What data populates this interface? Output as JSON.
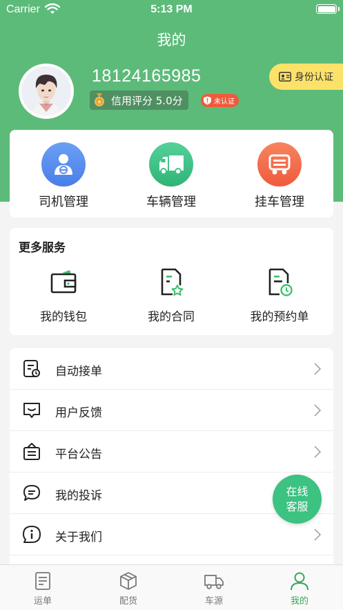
{
  "status_bar": {
    "carrier": "Carrier",
    "time": "5:13 PM"
  },
  "header": {
    "title": "我的"
  },
  "profile": {
    "phone": "18124165985",
    "credit_label": "信用评分 5.0分",
    "verify_status": "未认证",
    "id_verify_button": "身份认证"
  },
  "management": [
    {
      "label": "司机管理",
      "icon": "driver-icon",
      "color": "#5b8ff0"
    },
    {
      "label": "车辆管理",
      "icon": "truck-icon",
      "color": "#3ec18a"
    },
    {
      "label": "挂车管理",
      "icon": "trailer-icon",
      "color": "#f46d4d"
    }
  ],
  "services": {
    "title": "更多服务",
    "items": [
      {
        "label": "我的钱包",
        "icon": "wallet-icon"
      },
      {
        "label": "我的合同",
        "icon": "contract-icon"
      },
      {
        "label": "我的预约单",
        "icon": "appointment-icon"
      }
    ]
  },
  "menu": [
    {
      "label": "自动接单",
      "icon": "auto-order-icon"
    },
    {
      "label": "用户反馈",
      "icon": "feedback-icon"
    },
    {
      "label": "平台公告",
      "icon": "announcement-icon"
    },
    {
      "label": "我的投诉",
      "icon": "complaint-icon"
    },
    {
      "label": "关于我们",
      "icon": "info-icon"
    }
  ],
  "customer_service": {
    "line1": "在线",
    "line2": "客服"
  },
  "tabs": [
    {
      "label": "运单",
      "icon": "waybill-icon",
      "active": false
    },
    {
      "label": "配货",
      "icon": "cargo-box-icon",
      "active": false
    },
    {
      "label": "车源",
      "icon": "truck-source-icon",
      "active": false
    },
    {
      "label": "我的",
      "icon": "person-icon",
      "active": true
    }
  ],
  "colors": {
    "primary": "#5dbb7a",
    "accent_green": "#3cc281",
    "badge_red": "#f05a3a",
    "verify_yellow": "#fde26a"
  }
}
